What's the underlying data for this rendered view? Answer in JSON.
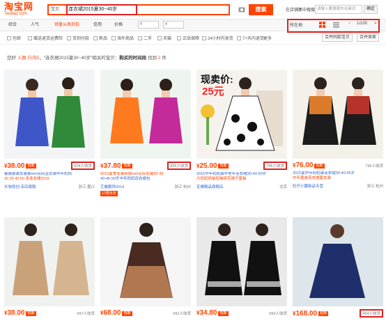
{
  "header": {
    "logo_cn": "淘宝网",
    "logo_en": "Taobao.com",
    "search_scope": "宝贝",
    "search_query": "连衣裙2015夏30~40岁",
    "search_button": "搜索",
    "shop_search_label": "在店铺集中搜搜",
    "shop_search_placeholder": "请输入要搜索的关键词",
    "shop_search_button": "确定"
  },
  "sortbar": {
    "items": [
      "综合",
      "人气",
      "销量从高到低",
      "信用",
      "价格"
    ],
    "price_from": "¥",
    "price_to": "¥",
    "location": "所在地",
    "pager": "1/100",
    "prev": "<",
    "next": ">"
  },
  "filters": {
    "options": [
      "包邮",
      "赠送退货运费险",
      "货到付款",
      "新品",
      "海外商品",
      "二手",
      "天猫",
      "正品保障",
      "24小时内发货",
      "7+天内退货"
    ],
    "more": "更多",
    "btn_merge_shop": "合并同款宝贝",
    "btn_merge_seller": "合并卖家"
  },
  "crumb": {
    "prefix": "您好",
    "tip1": "人数 行内5",
    "mid": "，“连衣裙2015夏30~40岁”相关的宝贝：",
    "bold": "购买的时间段",
    "found": "找到",
    "count": "2",
    "unit": "件"
  },
  "products": [
    {
      "price": "38.00",
      "badge": "包邮",
      "sales": "924人收货",
      "title_a": "春装装装女装装mm实际显女装中年妈妈",
      "title_b": "30 35 40 50 多连衣裙2015",
      "shop": "长坡原创 店店旗路",
      "loc": "浙江 嘉兴"
    },
    {
      "price": "37.80",
      "badge": "包邮",
      "sales": "825人收货",
      "title_a": "2015夏季女装新款mm实际女装30-35-",
      "title_b": "40-45-50岁中年妈妈连衣裙包",
      "shop": "艺麗服饰2014",
      "loc": "浙江 杭州",
      "tag": "17周年庆"
    },
    {
      "price": "25.00",
      "badge": "包邮",
      "sales": "796人收货",
      "title_a": "2015中年妈妈装中老年连衣裙30-40-50岁",
      "title_b": "大码妈妈装短袖碎花裙子夏装",
      "shop": "瓦楼精品旗舰店",
      "loc": "北京"
    },
    {
      "price": "76.00",
      "badge": "包邮",
      "sales": "736人收货",
      "title_a": "2015夏中年妈妈装连衣裙30-40-45岁",
      "title_b": "中年夏装连衣裙夏女装",
      "shop": "旺仔小趣新品专营",
      "loc": "浙江 杭州"
    },
    {
      "price": "38.00",
      "badge": "包邮",
      "sales": "697人收货",
      "title_a": "",
      "title_b": "",
      "shop": "",
      "loc": ""
    },
    {
      "price": "68.00",
      "badge": "包邮",
      "sales": "691人收货",
      "title_a": "",
      "title_b": "",
      "shop": "",
      "loc": ""
    },
    {
      "price": "34.80",
      "badge": "包邮",
      "sales": "593人收货",
      "title_a": "",
      "title_b": "",
      "shop": "",
      "loc": ""
    },
    {
      "price": "168.00",
      "badge": "包邮",
      "sales": "434人收货",
      "title_a": "",
      "title_b": "",
      "shop": "",
      "loc": ""
    }
  ],
  "colors": {
    "accent": "#ff4400",
    "highlight": "#e02020",
    "link": "#3366cc"
  }
}
